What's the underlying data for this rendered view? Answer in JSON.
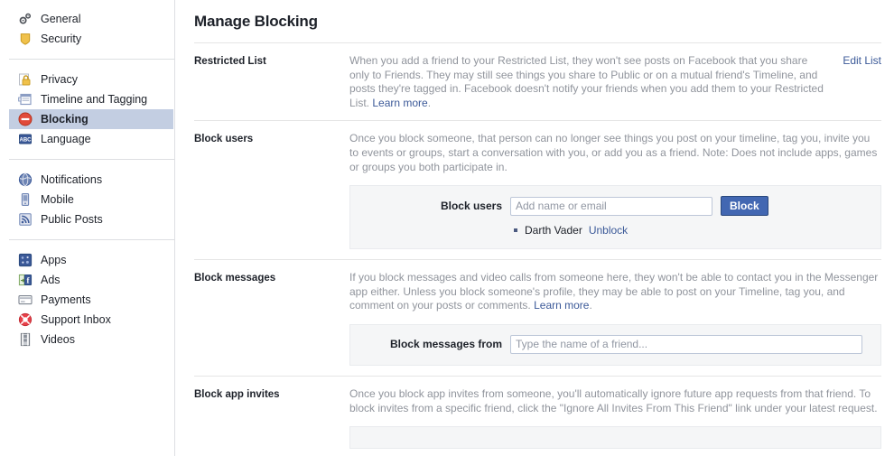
{
  "sidebar": {
    "groups": [
      {
        "items": [
          {
            "label": "General",
            "icon": "gears-icon",
            "name": "sidebar-item-general",
            "active": false
          },
          {
            "label": "Security",
            "icon": "shield-icon",
            "name": "sidebar-item-security",
            "active": false
          }
        ]
      },
      {
        "items": [
          {
            "label": "Privacy",
            "icon": "padlock-icon",
            "name": "sidebar-item-privacy",
            "active": false
          },
          {
            "label": "Timeline and Tagging",
            "icon": "timeline-icon",
            "name": "sidebar-item-timeline-and-tagging",
            "active": false
          },
          {
            "label": "Blocking",
            "icon": "no-entry-icon",
            "name": "sidebar-item-blocking",
            "active": true
          },
          {
            "label": "Language",
            "icon": "abc-badge-icon",
            "name": "sidebar-item-language",
            "active": false
          }
        ]
      },
      {
        "items": [
          {
            "label": "Notifications",
            "icon": "globe-icon",
            "name": "sidebar-item-notifications",
            "active": false
          },
          {
            "label": "Mobile",
            "icon": "phone-icon",
            "name": "sidebar-item-mobile",
            "active": false
          },
          {
            "label": "Public Posts",
            "icon": "rss-icon",
            "name": "sidebar-item-public-posts",
            "active": false
          }
        ]
      },
      {
        "items": [
          {
            "label": "Apps",
            "icon": "apps-icon",
            "name": "sidebar-item-apps",
            "active": false
          },
          {
            "label": "Ads",
            "icon": "ads-icon",
            "name": "sidebar-item-ads",
            "active": false
          },
          {
            "label": "Payments",
            "icon": "card-icon",
            "name": "sidebar-item-payments",
            "active": false
          },
          {
            "label": "Support Inbox",
            "icon": "lifering-icon",
            "name": "sidebar-item-support-inbox",
            "active": false
          },
          {
            "label": "Videos",
            "icon": "filmstrip-icon",
            "name": "sidebar-item-videos",
            "active": false
          }
        ]
      }
    ]
  },
  "main": {
    "title": "Manage Blocking",
    "sections": {
      "restricted_list": {
        "title": "Restricted List",
        "description": "When you add a friend to your Restricted List, they won't see posts on Facebook that you share only to Friends. They may still see things you share to Public or on a mutual friend's Timeline, and posts they're tagged in. Facebook doesn't notify your friends when you add them to your Restricted List.",
        "learn_more": "Learn more",
        "learn_more_period": ".",
        "action_label": "Edit List"
      },
      "block_users": {
        "title": "Block users",
        "description": "Once you block someone, that person can no longer see things you post on your timeline, tag you, invite you to events or groups, start a conversation with you, or add you as a friend. Note: Does not include apps, games or groups you both participate in.",
        "form_label": "Block users",
        "input_placeholder": "Add name or email",
        "input_value": "",
        "button_label": "Block",
        "blocked": [
          {
            "name": "Darth Vader",
            "action": "Unblock"
          }
        ]
      },
      "block_messages": {
        "title": "Block messages",
        "description": "If you block messages and video calls from someone here, they won't be able to contact you in the Messenger app either. Unless you block someone's profile, they may be able to post on your Timeline, tag you, and comment on your posts or comments.",
        "learn_more": "Learn more",
        "learn_more_period": ".",
        "form_label": "Block messages from",
        "input_placeholder": "Type the name of a friend...",
        "input_value": ""
      },
      "block_app_invites": {
        "title": "Block app invites",
        "description": "Once you block app invites from someone, you'll automatically ignore future app requests from that friend. To block invites from a specific friend, click the \"Ignore All Invites From This Friend\" link under your latest request."
      }
    }
  },
  "colors": {
    "accent": "#3b5998",
    "button": "#4267b2",
    "active_row": "#c3cee2",
    "muted_text": "#90949c",
    "panel_bg": "#f5f6f7"
  }
}
